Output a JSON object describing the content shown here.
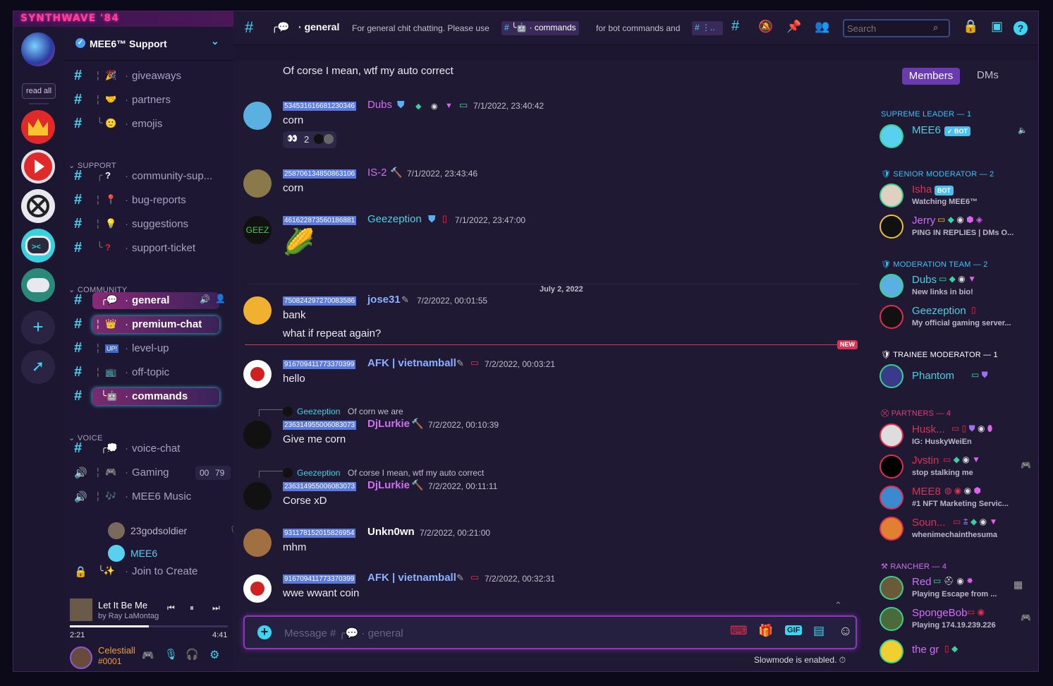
{
  "app": {
    "title": "SYNTHWAVE '84",
    "window_controls": [
      "—",
      "☐",
      "✕"
    ]
  },
  "guilds": {
    "read_all": "read all"
  },
  "server": {
    "name": "MEE6™ Support"
  },
  "channels": [
    {
      "id": "giveaways",
      "name": "giveaways"
    },
    {
      "id": "partners",
      "name": "partners"
    },
    {
      "id": "emojis",
      "name": "emojis"
    },
    {
      "id": "community-support",
      "name": "community-sup..."
    },
    {
      "id": "bug-reports",
      "name": "bug-reports"
    },
    {
      "id": "suggestions",
      "name": "suggestions"
    },
    {
      "id": "support-ticket",
      "name": "support-ticket"
    },
    {
      "id": "general",
      "name": "general"
    },
    {
      "id": "premium-chat",
      "name": "premium-chat"
    },
    {
      "id": "level-up",
      "name": "level-up"
    },
    {
      "id": "off-topic",
      "name": "off-topic"
    },
    {
      "id": "commands",
      "name": "commands"
    },
    {
      "id": "voice-chat",
      "name": "voice-chat"
    },
    {
      "id": "gaming",
      "name": "Gaming"
    },
    {
      "id": "mee6-music",
      "name": "MEE6 Music"
    },
    {
      "id": "join-to-create",
      "name": "Join to Create"
    }
  ],
  "categories": {
    "support": "SUPPORT",
    "community": "COMMUNITY",
    "voice": "VOICE"
  },
  "gaming_badge": {
    "a": "00",
    "b": "79"
  },
  "voice_users": [
    "23godsoldier",
    "MEE6"
  ],
  "player": {
    "song": "Let It Be Me",
    "artist": "by Ray LaMontag",
    "elapsed": "2:21",
    "total": "4:41",
    "progress": 0.5
  },
  "user": {
    "name": "Celestiall",
    "tag": "#0001"
  },
  "topbar": {
    "channel": "general",
    "topic_a": "For general chit chatting. Please use",
    "topic_cmd": "· commands",
    "topic_b": "for bot commands and",
    "search_placeholder": "Search"
  },
  "messages": [
    {
      "text": "Of corse I mean, wtf my auto correct"
    },
    {
      "id": "534531616681230346",
      "user": "Dubs",
      "time": "7/1/2022, 23:40:42",
      "text": "corn",
      "reaction": "2",
      "color": "#d070f0"
    },
    {
      "id": "258706134850863106",
      "user": "IS-2",
      "time": "7/1/2022, 23:43:46",
      "text": "corn",
      "color": "#d070f0"
    },
    {
      "id": "461622873560186881",
      "user": "Geezeption",
      "time": "7/1/2022, 23:47:00",
      "text": "🌽",
      "color": "#4ad0e0"
    },
    {
      "id": "750824297270083586",
      "user": "jose31",
      "time": "7/2/2022, 00:01:55",
      "text": "bank",
      "text2": "what if repeat again?",
      "color": "#8ab0ff"
    },
    {
      "id": "916709411773370399",
      "user": "AFK | vietnamball",
      "time": "7/2/2022, 00:03:21",
      "text": "hello",
      "color": "#8ab0ff"
    },
    {
      "reply_user": "Geezeption",
      "reply_text": "Of corn we are",
      "id": "236314955006083073",
      "user": "DjLurkie",
      "time": "7/2/2022, 00:10:39",
      "text": "Give me corn",
      "color": "#d070f0"
    },
    {
      "reply_user": "Geezeption",
      "reply_text": "Of corse I mean, wtf my auto correct",
      "id": "236314955006083073",
      "user": "DjLurkie",
      "time": "7/2/2022, 00:11:11",
      "text": "Corse xD",
      "color": "#d070f0"
    },
    {
      "id": "931178152015826954",
      "user": "Unkn0wn",
      "time": "7/2/2022, 00:21:00",
      "text": "mhm",
      "color": "#ffffff"
    },
    {
      "id": "916709411773370399",
      "user": "AFK | vietnamball",
      "time": "7/2/2022, 00:32:31",
      "text": "wwe wwant coin",
      "color": "#8ab0ff"
    }
  ],
  "date_divider": "July 2, 2022",
  "new_badge": "NEW",
  "composer": {
    "placeholder": "Message #",
    "channel": "general",
    "slowmode": "Slowmode is enabled."
  },
  "members_tabs": {
    "members": "Members",
    "dms": "DMs"
  },
  "member_groups": [
    {
      "title": "SUPREME LEADER — 1"
    },
    {
      "title": "SENIOR MODERATOR — 2"
    },
    {
      "title": "MODERATION TEAM — 2"
    },
    {
      "title": "TRAINEE MODERATOR — 1"
    },
    {
      "title": "PARTNERS — 4"
    },
    {
      "title": "RANCHER — 4"
    }
  ],
  "members": [
    {
      "name": "MEE6",
      "badge": "✓ BOT",
      "color": "#4ad0e0"
    },
    {
      "name": "Isha",
      "badge": "BOT",
      "status": "Watching MEE6™",
      "color": "#e03050"
    },
    {
      "name": "Jerry",
      "status": "PING IN REPLIES | DMs O...",
      "color": "#d070f0"
    },
    {
      "name": "Dubs",
      "status": "New links in bio!",
      "color": "#4ad0e0"
    },
    {
      "name": "Geezeption",
      "status": "My official gaming server...",
      "color": "#4ad0e0"
    },
    {
      "name": "Phantom",
      "color": "#4ad0e0"
    },
    {
      "name": "Husk...",
      "status": "IG: HuskyWeiEn",
      "color": "#e03050"
    },
    {
      "name": "Jvstin",
      "status": "stop stalking me",
      "color": "#e03050"
    },
    {
      "name": "MEE8",
      "status": "#1 NFT Marketing Servic...",
      "color": "#e03050"
    },
    {
      "name": "Soun...",
      "status": "whenimechainthesuma",
      "color": "#e03050"
    },
    {
      "name": "Red",
      "status": "Playing Escape from ...",
      "color": "#d070f0"
    },
    {
      "name": "SpongeBob",
      "status": "Playing 174.19.239.226",
      "color": "#d070f0"
    },
    {
      "name": "the gr",
      "color": "#d070f0"
    }
  ]
}
